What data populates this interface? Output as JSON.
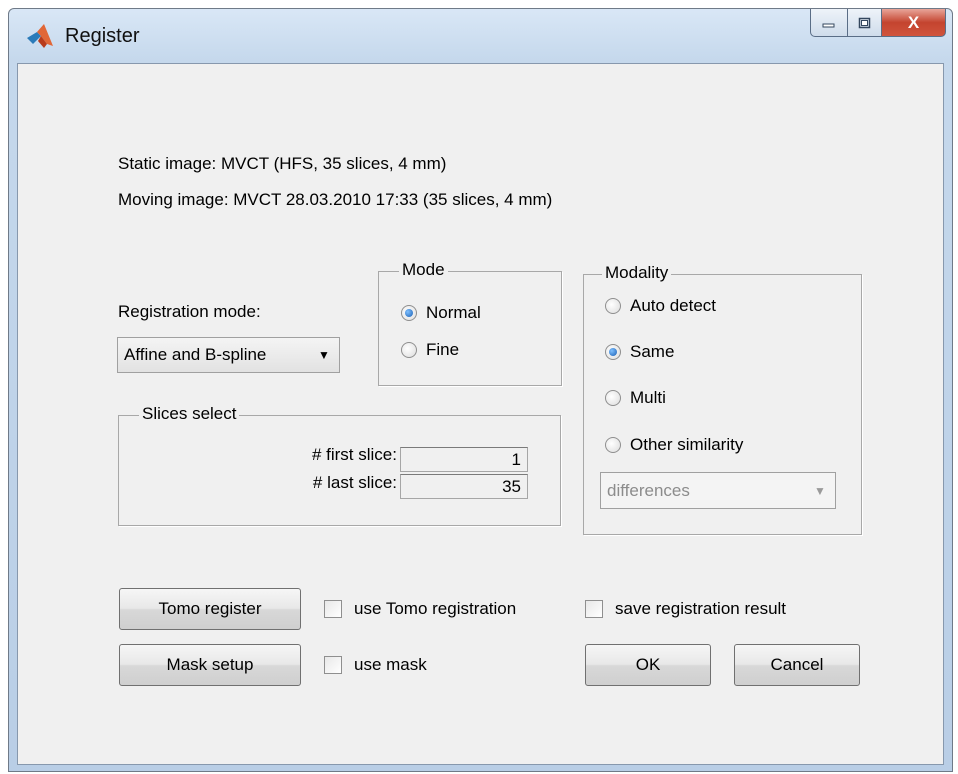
{
  "window": {
    "title": "Register",
    "minimize_glyph": "–",
    "maximize_glyph": "□",
    "close_glyph": "X"
  },
  "info": {
    "static_image": "Static image: MVCT (HFS, 35 slices, 4 mm)",
    "moving_image": "Moving image: MVCT 28.03.2010 17:33 (35 slices, 4 mm)"
  },
  "registration": {
    "label": "Registration mode:",
    "selected": "Affine and B-spline"
  },
  "mode": {
    "title": "Mode",
    "options": [
      {
        "label": "Normal",
        "checked": true
      },
      {
        "label": "Fine",
        "checked": false
      }
    ]
  },
  "modality": {
    "title": "Modality",
    "options": [
      {
        "label": "Auto detect",
        "checked": false
      },
      {
        "label": "Same",
        "checked": true
      },
      {
        "label": "Multi",
        "checked": false
      },
      {
        "label": "Other similarity",
        "checked": false
      }
    ],
    "similarity_selected": "differences",
    "similarity_enabled": false
  },
  "slices": {
    "title": "Slices select",
    "first_label": "# first slice:",
    "first_value": "1",
    "last_label": "# last slice:",
    "last_value": "35"
  },
  "buttons": {
    "tomo_register": "Tomo register",
    "mask_setup": "Mask setup",
    "ok": "OK",
    "cancel": "Cancel"
  },
  "checkboxes": {
    "use_tomo": {
      "label": "use Tomo registration",
      "checked": false
    },
    "save_result": {
      "label": "save registration result",
      "checked": false
    },
    "use_mask": {
      "label": "use mask",
      "checked": false
    }
  },
  "icons": {
    "app": "matlab-logo-icon",
    "dropdown": "dropdown-arrow-icon"
  },
  "colors": {
    "title_bar": "#c5d8ec",
    "close_button": "#c4442f",
    "panel_background": "#f0f0f0",
    "radio_selected": "#1a5fb4"
  }
}
